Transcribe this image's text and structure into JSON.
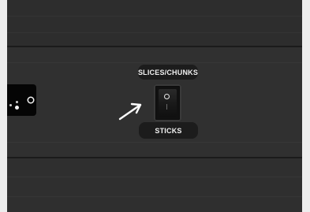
{
  "switch": {
    "top_label": "SLICES/CHUNKS",
    "bottom_label": "STICKS",
    "on_symbol": "circle-on-mark",
    "off_symbol": "line-off-mark"
  },
  "icons": {
    "pointer": "arrow-pointer-icon",
    "side_control": "dots-icon"
  },
  "colors": {
    "panel": "#303030",
    "label_bg": "#1c1c1c",
    "label_text": "#f1f1f1",
    "frame": "#ededed"
  }
}
